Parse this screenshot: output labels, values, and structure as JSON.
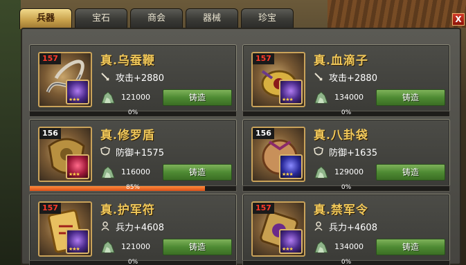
{
  "tabs": [
    {
      "label": "兵器",
      "active": true
    },
    {
      "label": "宝石",
      "active": false
    },
    {
      "label": "商会",
      "active": false
    },
    {
      "label": "器械",
      "active": false
    },
    {
      "label": "珍宝",
      "active": false
    }
  ],
  "close_label": "X",
  "items": [
    {
      "level": "157",
      "name": "真.乌蚕鞭",
      "stat_icon": "sword-icon",
      "stat": "攻击+2880",
      "cost": "121000",
      "button": "铸造",
      "progress": "0%",
      "progress_value": 0,
      "gem": "purple"
    },
    {
      "level": "157",
      "name": "真.血滴子",
      "stat_icon": "sword-icon",
      "stat": "攻击+2880",
      "cost": "134000",
      "button": "铸造",
      "progress": "0%",
      "progress_value": 0,
      "gem": "purple"
    },
    {
      "level": "156",
      "name": "真.修罗盾",
      "stat_icon": "shield-icon",
      "stat": "防御+1575",
      "cost": "116000",
      "button": "铸造",
      "progress": "85%",
      "progress_value": 85,
      "gem": "red"
    },
    {
      "level": "156",
      "name": "真.八卦袋",
      "stat_icon": "shield-icon",
      "stat": "防御+1635",
      "cost": "129000",
      "button": "铸造",
      "progress": "0%",
      "progress_value": 0,
      "gem": "blue"
    },
    {
      "level": "157",
      "name": "真.护军符",
      "stat_icon": "soldier-icon",
      "stat": "兵力+4608",
      "cost": "121000",
      "button": "铸造",
      "progress": "0%",
      "progress_value": 0,
      "gem": "purple"
    },
    {
      "level": "157",
      "name": "真.禁军令",
      "stat_icon": "soldier-icon",
      "stat": "兵力+4608",
      "cost": "134000",
      "button": "铸造",
      "progress": "0%",
      "progress_value": 0,
      "gem": "purple"
    }
  ],
  "colors": {
    "level_157": "#ff3a2a",
    "level_156": "#ffffff",
    "name": "#f0c85a",
    "progress_fill": "#ff8a3a"
  }
}
